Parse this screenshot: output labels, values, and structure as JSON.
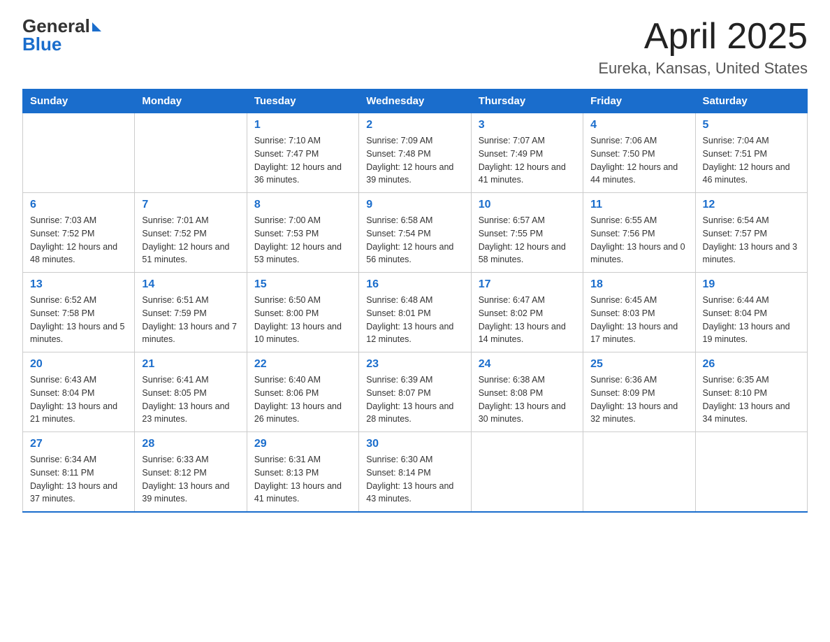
{
  "header": {
    "logo_text_general": "General",
    "logo_text_blue": "Blue",
    "calendar_title": "April 2025",
    "calendar_subtitle": "Eureka, Kansas, United States"
  },
  "weekdays": [
    "Sunday",
    "Monday",
    "Tuesday",
    "Wednesday",
    "Thursday",
    "Friday",
    "Saturday"
  ],
  "weeks": [
    [
      {
        "day": "",
        "sunrise": "",
        "sunset": "",
        "daylight": ""
      },
      {
        "day": "",
        "sunrise": "",
        "sunset": "",
        "daylight": ""
      },
      {
        "day": "1",
        "sunrise": "Sunrise: 7:10 AM",
        "sunset": "Sunset: 7:47 PM",
        "daylight": "Daylight: 12 hours and 36 minutes."
      },
      {
        "day": "2",
        "sunrise": "Sunrise: 7:09 AM",
        "sunset": "Sunset: 7:48 PM",
        "daylight": "Daylight: 12 hours and 39 minutes."
      },
      {
        "day": "3",
        "sunrise": "Sunrise: 7:07 AM",
        "sunset": "Sunset: 7:49 PM",
        "daylight": "Daylight: 12 hours and 41 minutes."
      },
      {
        "day": "4",
        "sunrise": "Sunrise: 7:06 AM",
        "sunset": "Sunset: 7:50 PM",
        "daylight": "Daylight: 12 hours and 44 minutes."
      },
      {
        "day": "5",
        "sunrise": "Sunrise: 7:04 AM",
        "sunset": "Sunset: 7:51 PM",
        "daylight": "Daylight: 12 hours and 46 minutes."
      }
    ],
    [
      {
        "day": "6",
        "sunrise": "Sunrise: 7:03 AM",
        "sunset": "Sunset: 7:52 PM",
        "daylight": "Daylight: 12 hours and 48 minutes."
      },
      {
        "day": "7",
        "sunrise": "Sunrise: 7:01 AM",
        "sunset": "Sunset: 7:52 PM",
        "daylight": "Daylight: 12 hours and 51 minutes."
      },
      {
        "day": "8",
        "sunrise": "Sunrise: 7:00 AM",
        "sunset": "Sunset: 7:53 PM",
        "daylight": "Daylight: 12 hours and 53 minutes."
      },
      {
        "day": "9",
        "sunrise": "Sunrise: 6:58 AM",
        "sunset": "Sunset: 7:54 PM",
        "daylight": "Daylight: 12 hours and 56 minutes."
      },
      {
        "day": "10",
        "sunrise": "Sunrise: 6:57 AM",
        "sunset": "Sunset: 7:55 PM",
        "daylight": "Daylight: 12 hours and 58 minutes."
      },
      {
        "day": "11",
        "sunrise": "Sunrise: 6:55 AM",
        "sunset": "Sunset: 7:56 PM",
        "daylight": "Daylight: 13 hours and 0 minutes."
      },
      {
        "day": "12",
        "sunrise": "Sunrise: 6:54 AM",
        "sunset": "Sunset: 7:57 PM",
        "daylight": "Daylight: 13 hours and 3 minutes."
      }
    ],
    [
      {
        "day": "13",
        "sunrise": "Sunrise: 6:52 AM",
        "sunset": "Sunset: 7:58 PM",
        "daylight": "Daylight: 13 hours and 5 minutes."
      },
      {
        "day": "14",
        "sunrise": "Sunrise: 6:51 AM",
        "sunset": "Sunset: 7:59 PM",
        "daylight": "Daylight: 13 hours and 7 minutes."
      },
      {
        "day": "15",
        "sunrise": "Sunrise: 6:50 AM",
        "sunset": "Sunset: 8:00 PM",
        "daylight": "Daylight: 13 hours and 10 minutes."
      },
      {
        "day": "16",
        "sunrise": "Sunrise: 6:48 AM",
        "sunset": "Sunset: 8:01 PM",
        "daylight": "Daylight: 13 hours and 12 minutes."
      },
      {
        "day": "17",
        "sunrise": "Sunrise: 6:47 AM",
        "sunset": "Sunset: 8:02 PM",
        "daylight": "Daylight: 13 hours and 14 minutes."
      },
      {
        "day": "18",
        "sunrise": "Sunrise: 6:45 AM",
        "sunset": "Sunset: 8:03 PM",
        "daylight": "Daylight: 13 hours and 17 minutes."
      },
      {
        "day": "19",
        "sunrise": "Sunrise: 6:44 AM",
        "sunset": "Sunset: 8:04 PM",
        "daylight": "Daylight: 13 hours and 19 minutes."
      }
    ],
    [
      {
        "day": "20",
        "sunrise": "Sunrise: 6:43 AM",
        "sunset": "Sunset: 8:04 PM",
        "daylight": "Daylight: 13 hours and 21 minutes."
      },
      {
        "day": "21",
        "sunrise": "Sunrise: 6:41 AM",
        "sunset": "Sunset: 8:05 PM",
        "daylight": "Daylight: 13 hours and 23 minutes."
      },
      {
        "day": "22",
        "sunrise": "Sunrise: 6:40 AM",
        "sunset": "Sunset: 8:06 PM",
        "daylight": "Daylight: 13 hours and 26 minutes."
      },
      {
        "day": "23",
        "sunrise": "Sunrise: 6:39 AM",
        "sunset": "Sunset: 8:07 PM",
        "daylight": "Daylight: 13 hours and 28 minutes."
      },
      {
        "day": "24",
        "sunrise": "Sunrise: 6:38 AM",
        "sunset": "Sunset: 8:08 PM",
        "daylight": "Daylight: 13 hours and 30 minutes."
      },
      {
        "day": "25",
        "sunrise": "Sunrise: 6:36 AM",
        "sunset": "Sunset: 8:09 PM",
        "daylight": "Daylight: 13 hours and 32 minutes."
      },
      {
        "day": "26",
        "sunrise": "Sunrise: 6:35 AM",
        "sunset": "Sunset: 8:10 PM",
        "daylight": "Daylight: 13 hours and 34 minutes."
      }
    ],
    [
      {
        "day": "27",
        "sunrise": "Sunrise: 6:34 AM",
        "sunset": "Sunset: 8:11 PM",
        "daylight": "Daylight: 13 hours and 37 minutes."
      },
      {
        "day": "28",
        "sunrise": "Sunrise: 6:33 AM",
        "sunset": "Sunset: 8:12 PM",
        "daylight": "Daylight: 13 hours and 39 minutes."
      },
      {
        "day": "29",
        "sunrise": "Sunrise: 6:31 AM",
        "sunset": "Sunset: 8:13 PM",
        "daylight": "Daylight: 13 hours and 41 minutes."
      },
      {
        "day": "30",
        "sunrise": "Sunrise: 6:30 AM",
        "sunset": "Sunset: 8:14 PM",
        "daylight": "Daylight: 13 hours and 43 minutes."
      },
      {
        "day": "",
        "sunrise": "",
        "sunset": "",
        "daylight": ""
      },
      {
        "day": "",
        "sunrise": "",
        "sunset": "",
        "daylight": ""
      },
      {
        "day": "",
        "sunrise": "",
        "sunset": "",
        "daylight": ""
      }
    ]
  ]
}
